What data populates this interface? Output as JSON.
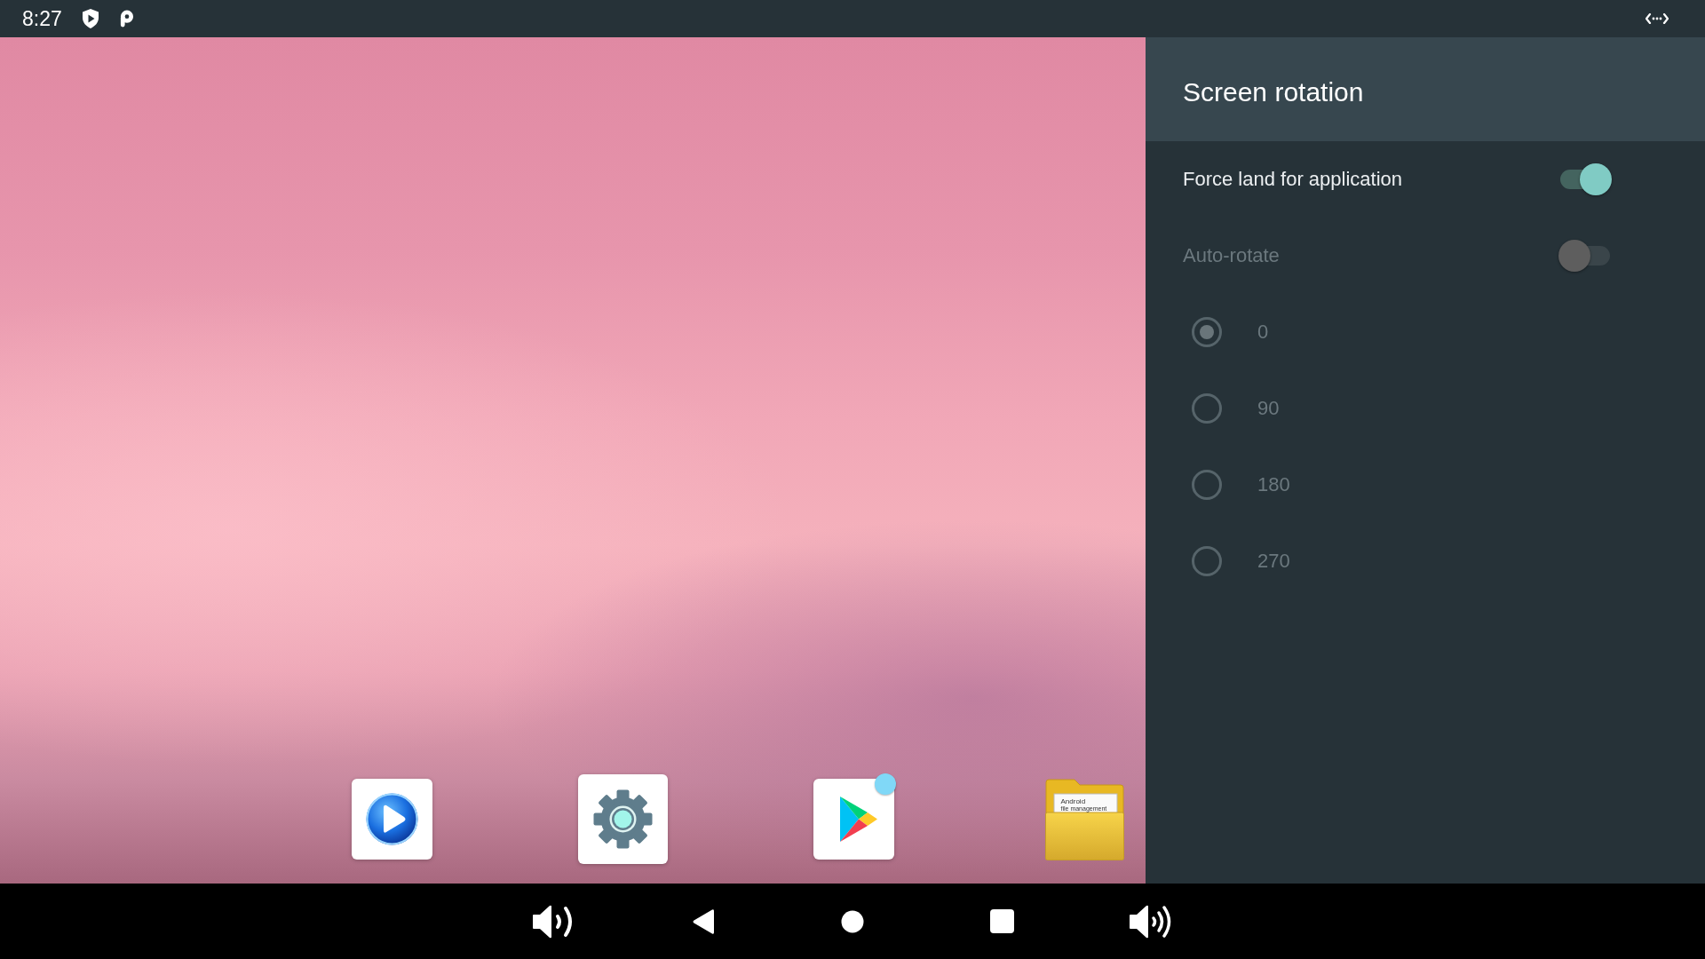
{
  "status_bar": {
    "time": "8:27"
  },
  "desktop": {
    "dock": [
      {
        "kind": "video_player",
        "badge": false
      },
      {
        "kind": "settings",
        "badge": false
      },
      {
        "kind": "play_store",
        "badge": true
      },
      {
        "kind": "file_manager",
        "badge": false,
        "label": "Android",
        "sublabel": "file management"
      }
    ]
  },
  "panel": {
    "title": "Screen rotation",
    "switches": [
      {
        "label": "Force land for application",
        "on": true,
        "disabled": false
      },
      {
        "label": "Auto-rotate",
        "on": false,
        "disabled": true
      }
    ],
    "options": [
      {
        "label": "0",
        "selected": true,
        "disabled": true
      },
      {
        "label": "90",
        "selected": false,
        "disabled": true
      },
      {
        "label": "180",
        "selected": false,
        "disabled": true
      },
      {
        "label": "270",
        "selected": false,
        "disabled": true
      }
    ]
  }
}
